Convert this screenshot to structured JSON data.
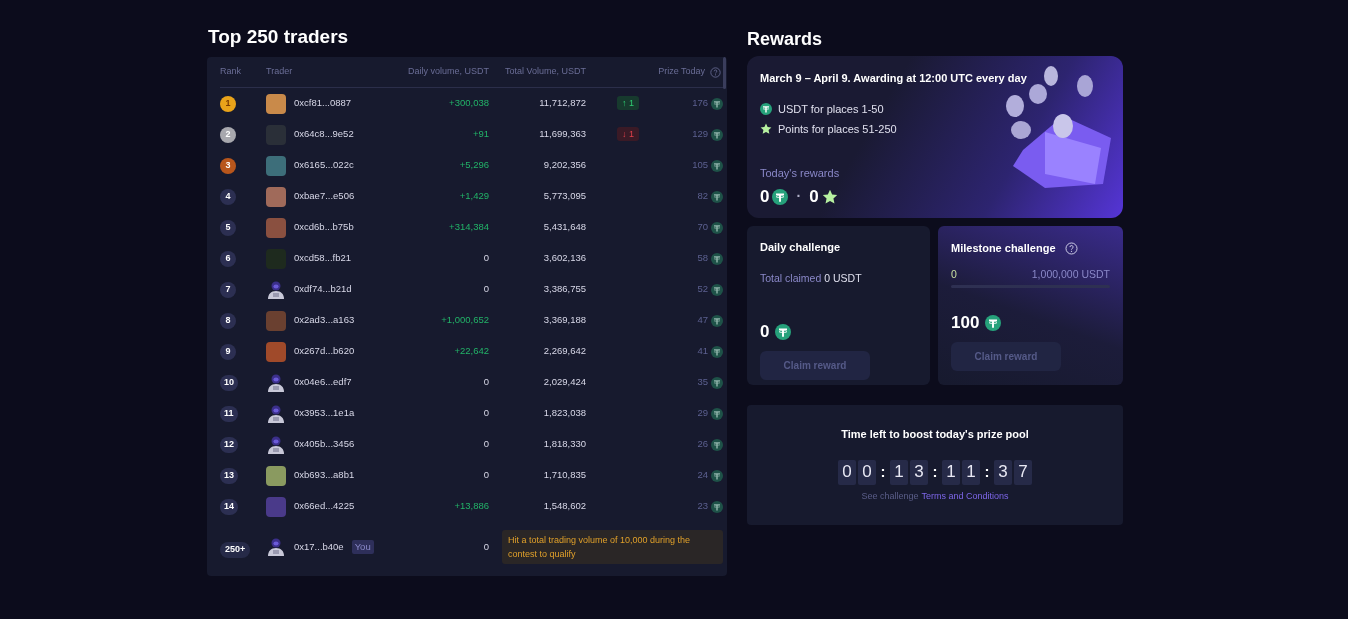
{
  "leaderboard": {
    "title": "Top 250 traders",
    "columns": [
      "Rank",
      "Trader",
      "Daily volume, USDT",
      "Total Volume, USDT",
      "Prize Today"
    ],
    "rows": [
      {
        "rank": "1",
        "color": "#e9a31a",
        "kind": "photo",
        "trader": "0xcf81...0887",
        "daily": "+300,038",
        "total": "11,712,872",
        "change": {
          "up": true,
          "text": "↑ 1"
        },
        "prize": "176"
      },
      {
        "rank": "2",
        "color": "#a8a8ae",
        "kind": "photo",
        "trader": "0x64c8...9e52",
        "daily": "+91",
        "total": "11,699,363",
        "change": {
          "up": false,
          "text": "↓ 1"
        },
        "prize": "129"
      },
      {
        "rank": "3",
        "color": "#b8561c",
        "kind": "photo",
        "trader": "0x6165...022c",
        "daily": "+5,296",
        "total": "9,202,356",
        "prize": "105"
      },
      {
        "rank": "4",
        "color": "#2c2f52",
        "kind": "photo",
        "trader": "0xbae7...e506",
        "daily": "+1,429",
        "total": "5,773,095",
        "prize": "82"
      },
      {
        "rank": "5",
        "color": "#2c2f52",
        "kind": "photo",
        "trader": "0xcd6b...b75b",
        "daily": "+314,384",
        "total": "5,431,648",
        "prize": "70"
      },
      {
        "rank": "6",
        "color": "#2c2f52",
        "kind": "photo",
        "trader": "0xcd58...fb21",
        "daily": "0",
        "total": "3,602,136",
        "prize": "58"
      },
      {
        "rank": "7",
        "color": "#2c2f52",
        "kind": "default",
        "trader": "0xdf74...b21d",
        "daily": "0",
        "total": "3,386,755",
        "prize": "52"
      },
      {
        "rank": "8",
        "color": "#2c2f52",
        "kind": "photo",
        "trader": "0x2ad3...a163",
        "daily": "+1,000,652",
        "total": "3,369,188",
        "prize": "47"
      },
      {
        "rank": "9",
        "color": "#2c2f52",
        "kind": "photo",
        "trader": "0x267d...b620",
        "daily": "+22,642",
        "total": "2,269,642",
        "prize": "41"
      },
      {
        "rank": "10",
        "color": "#2c2f52",
        "kind": "default",
        "trader": "0x04e6...edf7",
        "daily": "0",
        "total": "2,029,424",
        "prize": "35"
      },
      {
        "rank": "11",
        "color": "#2c2f52",
        "kind": "default",
        "trader": "0x3953...1e1a",
        "daily": "0",
        "total": "1,823,038",
        "prize": "29"
      },
      {
        "rank": "12",
        "color": "#2c2f52",
        "kind": "default",
        "trader": "0x405b...3456",
        "daily": "0",
        "total": "1,818,330",
        "prize": "26"
      },
      {
        "rank": "13",
        "color": "#2c2f52",
        "kind": "photo",
        "trader": "0xb693...a8b1",
        "daily": "0",
        "total": "1,710,835",
        "prize": "24"
      },
      {
        "rank": "14",
        "color": "#2c2f52",
        "kind": "photo",
        "trader": "0x66ed...4225",
        "daily": "+13,886",
        "total": "1,548,602",
        "prize": "23"
      }
    ],
    "you": {
      "rank": "250+",
      "kind": "default",
      "trader": "0x17...b40e",
      "tag": "You",
      "daily": "0",
      "notice": "Hit a total trading volume of 10,000 during the contest to qualify"
    }
  },
  "rewards": {
    "title": "Rewards",
    "period": "March 9 – April 9. Awarding at 12:00 UTC every day",
    "perks": [
      {
        "kind": "usdt",
        "text": "USDT for places 1-50"
      },
      {
        "kind": "points",
        "text": "Points for places 51-250"
      }
    ],
    "today_label": "Today's rewards",
    "today_usdt": "0",
    "separator": "·",
    "today_points": "0"
  },
  "daily_challenge": {
    "title": "Daily challenge",
    "claimed_label": "Total claimed",
    "claimed_value": "0 USDT",
    "amount": "0",
    "button": "Claim reward",
    "disabled": true
  },
  "milestone_challenge": {
    "title": "Milestone challenge",
    "progress_start": "0",
    "progress_goal": "1,000,000 USDT",
    "level": 0,
    "amount": "100",
    "button": "Claim reward",
    "disabled": true
  },
  "timer": {
    "title": "Time left to boost today's prize pool",
    "cells": [
      {
        "kind": "digit",
        "text": "0"
      },
      {
        "kind": "digit",
        "text": "0"
      },
      {
        "kind": "separator",
        "text": ":"
      },
      {
        "kind": "digit",
        "text": "1"
      },
      {
        "kind": "digit",
        "text": "3"
      },
      {
        "kind": "separator",
        "text": ":"
      },
      {
        "kind": "digit",
        "text": "1"
      },
      {
        "kind": "digit",
        "text": "1"
      },
      {
        "kind": "separator",
        "text": ":"
      },
      {
        "kind": "digit",
        "text": "3"
      },
      {
        "kind": "digit",
        "text": "7"
      }
    ],
    "note": "See challenge",
    "link": "Terms and Conditions"
  }
}
